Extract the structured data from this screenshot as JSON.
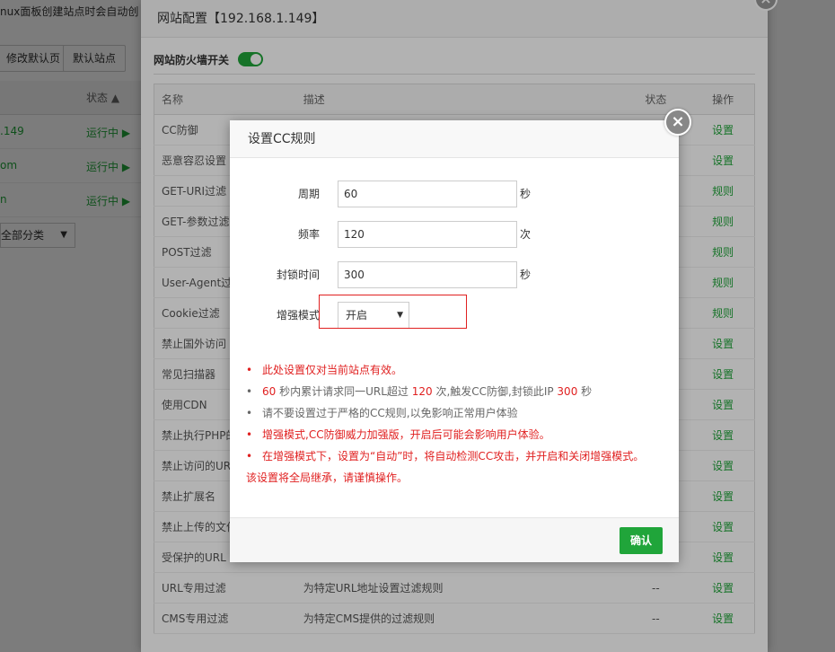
{
  "background": {
    "notice": "nux面板创建站点时会自动创",
    "buttons": [
      "修改默认页",
      "默认站点"
    ],
    "status_header": "状态",
    "sort_icon": "triangle-up-icon",
    "sites": [
      {
        "name": ".149",
        "status": "运行中"
      },
      {
        "name": "om",
        "status": "运行中"
      },
      {
        "name": "n",
        "status": "运行中"
      }
    ],
    "category_select": "全部分类"
  },
  "main_dialog": {
    "title": "网站配置【192.168.1.149】",
    "firewall_label": "网站防火墙开关",
    "firewall_on": true,
    "headers": {
      "name": "名称",
      "desc": "描述",
      "status": "状态",
      "op": "操作"
    },
    "rows": [
      {
        "name": "CC防御",
        "desc": "",
        "status": "",
        "op": "设置"
      },
      {
        "name": "恶意容忍设置",
        "desc": "",
        "status": "",
        "op": "设置"
      },
      {
        "name": "GET-URI过滤",
        "desc": "",
        "status": "",
        "op": "规则"
      },
      {
        "name": "GET-参数过滤",
        "desc": "",
        "status": "",
        "op": "规则"
      },
      {
        "name": "POST过滤",
        "desc": "",
        "status": "",
        "op": "规则"
      },
      {
        "name": "User-Agent过",
        "desc": "",
        "status": "",
        "op": "规则"
      },
      {
        "name": "Cookie过滤",
        "desc": "",
        "status": "",
        "op": "规则"
      },
      {
        "name": "禁止国外访问",
        "desc": "",
        "status": "",
        "op": "设置"
      },
      {
        "name": "常见扫描器",
        "desc": "",
        "status": "",
        "op": "设置"
      },
      {
        "name": "使用CDN",
        "desc": "",
        "status": "",
        "op": "设置"
      },
      {
        "name": "禁止执行PHP的",
        "desc": "",
        "status": "",
        "op": "设置"
      },
      {
        "name": "禁止访问的UR",
        "desc": "",
        "status": "",
        "op": "设置"
      },
      {
        "name": "禁止扩展名",
        "desc": "",
        "status": "",
        "op": "设置"
      },
      {
        "name": "禁止上传的文件",
        "desc": "",
        "status": "",
        "op": "设置"
      },
      {
        "name": "受保护的URL",
        "desc": "",
        "status": "",
        "op": "设置"
      },
      {
        "name": "URL专用过滤",
        "desc": "为特定URL地址设置过滤规则",
        "status": "--",
        "op": "设置"
      },
      {
        "name": "CMS专用过滤",
        "desc": "为特定CMS提供的过滤规则",
        "status": "--",
        "op": "设置"
      }
    ]
  },
  "cc_dialog": {
    "title": "设置CC规则",
    "close_icon": "close-icon",
    "fields": {
      "period": {
        "label": "周期",
        "value": "60",
        "unit": "秒"
      },
      "frequency": {
        "label": "频率",
        "value": "120",
        "unit": "次"
      },
      "block_time": {
        "label": "封锁时间",
        "value": "300",
        "unit": "秒"
      },
      "enhanced": {
        "label": "增强模式",
        "value": "开启"
      }
    },
    "tips": {
      "t1": "此处设置仅对当前站点有效。",
      "t2_a": "60",
      "t2_b": " 秒内累计请求同一URL超过 ",
      "t2_c": "120",
      "t2_d": " 次,触发CC防御,封锁此IP ",
      "t2_e": "300",
      "t2_f": " 秒",
      "t3": "请不要设置过于严格的CC规则,以免影响正常用户体验",
      "t4": "增强模式,CC防御威力加强版，开启后可能会影响用户体验。",
      "t5": "在增强模式下，设置为“自动”时，将自动检测CC攻击，并开启和关闭增强模式。",
      "t5_cont": "该设置将全局继承，请谨慎操作。"
    },
    "confirm_label": "确认"
  }
}
